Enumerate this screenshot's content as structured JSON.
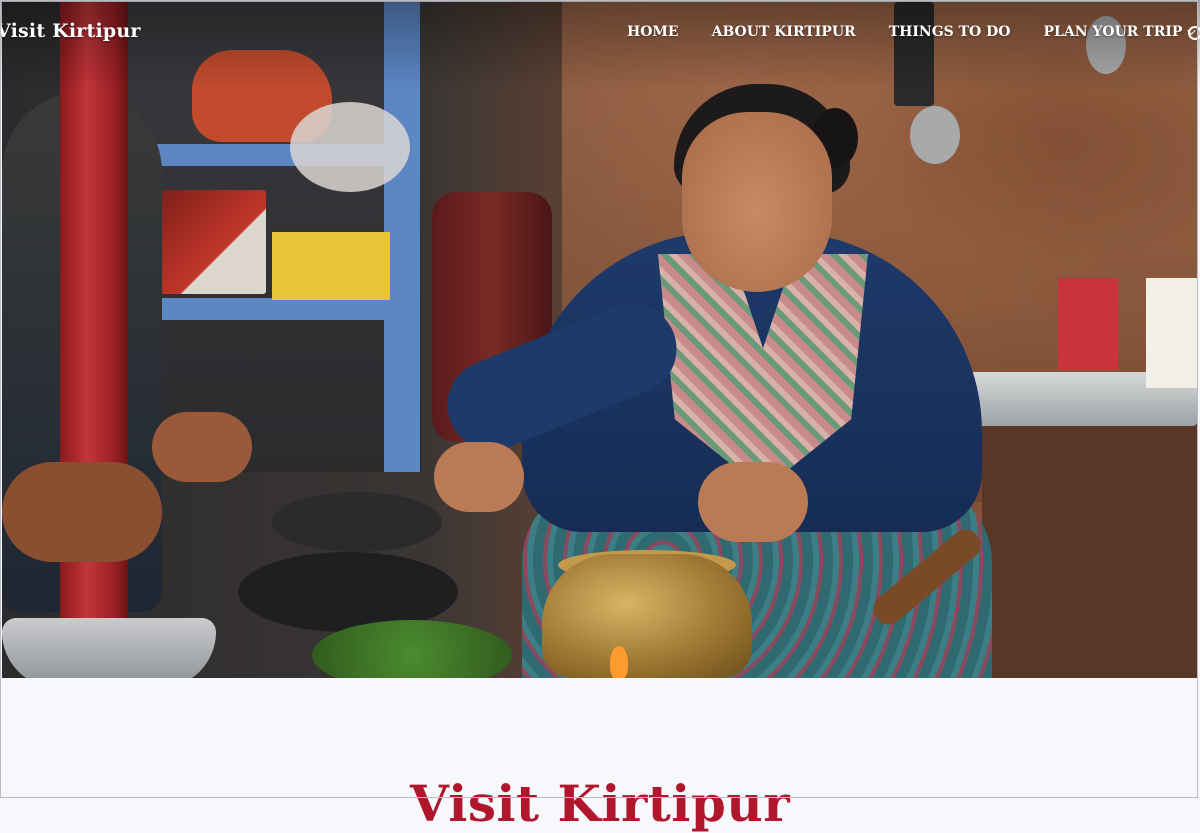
{
  "site": {
    "logo_text": "Visit Kirtipur"
  },
  "nav": {
    "items": [
      {
        "label": "HOME"
      },
      {
        "label": "ABOUT KIRTIPUR"
      },
      {
        "label": "THINGS TO DO"
      },
      {
        "label": "PLAN YOUR TRIP",
        "has_dropdown": true
      }
    ],
    "search_icon": "search-icon"
  },
  "hero": {
    "image_description_icon": "hero-photo"
  },
  "intro": {
    "title": "Visit Kirtipur"
  },
  "colors": {
    "accent": "#b1172c",
    "nav_text": "#ffffff",
    "page_bg": "#f7f8fb"
  }
}
